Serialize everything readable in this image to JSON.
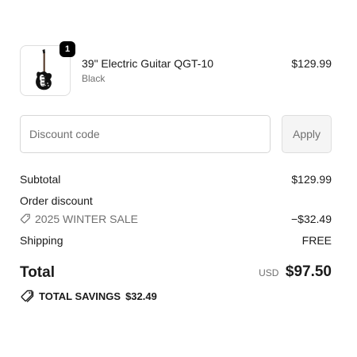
{
  "line_item": {
    "quantity": "1",
    "name": "39\" Electric Guitar QGT-10",
    "variant": "Black",
    "price": "$129.99",
    "image_icon": "electric-guitar-image"
  },
  "discount": {
    "placeholder": "Discount code",
    "value": "",
    "apply_label": "Apply"
  },
  "summary": {
    "subtotal_label": "Subtotal",
    "subtotal_value": "$129.99",
    "order_discount_label": "Order discount",
    "discount_code": "2025 WINTER SALE",
    "discount_amount": "−$32.49",
    "discount_icon": "tag-icon",
    "shipping_label": "Shipping",
    "shipping_value": "FREE",
    "total_label": "Total",
    "currency": "USD",
    "total_value": "$97.50",
    "savings_label": "TOTAL SAVINGS",
    "savings_value": "$32.49",
    "savings_icon": "tags-icon"
  }
}
